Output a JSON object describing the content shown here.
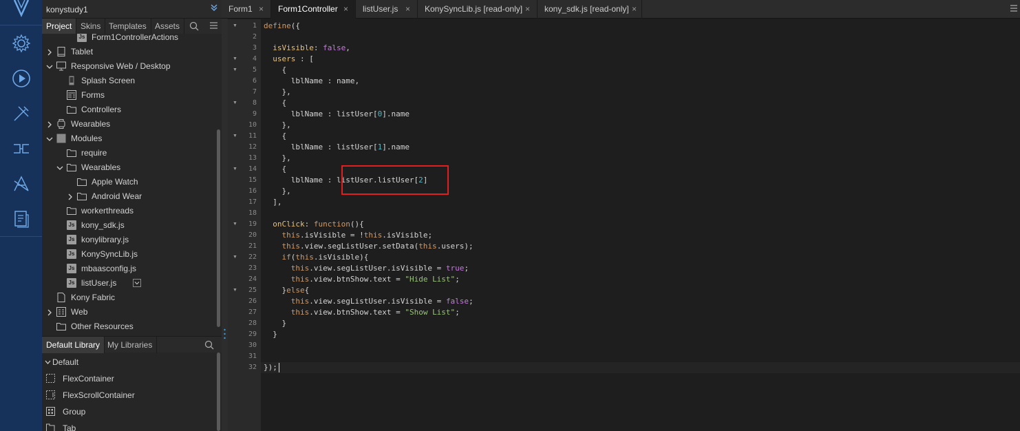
{
  "project_panel": {
    "workspace_name": "konystudy1",
    "tabs": [
      "Project",
      "Skins",
      "Templates",
      "Assets"
    ],
    "tree": [
      {
        "label": "Form1ControllerActions",
        "type": "js",
        "indent": 2,
        "chevron": ""
      },
      {
        "label": "Tablet",
        "type": "tablet",
        "indent": 0,
        "chevron": "right"
      },
      {
        "label": "Responsive Web / Desktop",
        "type": "desktop",
        "indent": 0,
        "chevron": "down"
      },
      {
        "label": "Splash Screen",
        "type": "phone",
        "indent": 1,
        "chevron": ""
      },
      {
        "label": "Forms",
        "type": "forms",
        "indent": 1,
        "chevron": ""
      },
      {
        "label": "Controllers",
        "type": "folder",
        "indent": 1,
        "chevron": ""
      },
      {
        "label": "Wearables",
        "type": "watch",
        "indent": 0,
        "chevron": "right"
      },
      {
        "label": "Modules",
        "type": "modules",
        "indent": 0,
        "chevron": "down"
      },
      {
        "label": "require",
        "type": "folder",
        "indent": 1,
        "chevron": ""
      },
      {
        "label": "Wearables",
        "type": "folder",
        "indent": 1,
        "chevron": "down"
      },
      {
        "label": "Apple Watch",
        "type": "folder",
        "indent": 2,
        "chevron": ""
      },
      {
        "label": "Android Wear",
        "type": "folder",
        "indent": 2,
        "chevron": "right"
      },
      {
        "label": "workerthreads",
        "type": "folder",
        "indent": 1,
        "chevron": ""
      },
      {
        "label": "kony_sdk.js",
        "type": "js",
        "indent": 1,
        "chevron": ""
      },
      {
        "label": "konylibrary.js",
        "type": "js",
        "indent": 1,
        "chevron": ""
      },
      {
        "label": "KonySyncLib.js",
        "type": "js",
        "indent": 1,
        "chevron": ""
      },
      {
        "label": "mbaasconfig.js",
        "type": "js",
        "indent": 1,
        "chevron": ""
      },
      {
        "label": "listUser.js",
        "type": "js",
        "indent": 1,
        "chevron": "",
        "dropdown": true
      },
      {
        "label": "Kony Fabric",
        "type": "file",
        "indent": 0,
        "chevron": ""
      },
      {
        "label": "Web",
        "type": "web",
        "indent": 0,
        "chevron": "right"
      },
      {
        "label": "Other Resources",
        "type": "folder",
        "indent": 0,
        "chevron": ""
      }
    ]
  },
  "library_panel": {
    "tabs": [
      "Default Library",
      "My Libraries"
    ],
    "group_label": "Default",
    "items": [
      "FlexContainer",
      "FlexScrollContainer",
      "Group",
      "Tab"
    ]
  },
  "editor": {
    "tabs": [
      {
        "label": "Form1",
        "active": false
      },
      {
        "label": "Form1Controller",
        "active": true
      },
      {
        "label": "listUser.js",
        "active": false
      },
      {
        "label": "KonySyncLib.js [read-only]",
        "active": false
      },
      {
        "label": "kony_sdk.js [read-only]",
        "active": false
      }
    ],
    "close_glyph": "×",
    "line_numbers": [
      "1",
      "2",
      "3",
      "4",
      "5",
      "6",
      "7",
      "8",
      "9",
      "10",
      "11",
      "12",
      "13",
      "14",
      "15",
      "16",
      "17",
      "18",
      "19",
      "20",
      "21",
      "22",
      "23",
      "24",
      "25",
      "26",
      "27",
      "28",
      "29",
      "30",
      "31",
      "32"
    ],
    "fold_lines": [
      1,
      4,
      5,
      8,
      11,
      14,
      19,
      22,
      25
    ],
    "code_lines": [
      "define({",
      "",
      "  isVisible: false,",
      "  users : [",
      "    {",
      "      lblName : name,",
      "    },",
      "    {",
      "      lblName : listUser[0].name",
      "    },",
      "    {",
      "      lblName : listUser[1].name",
      "    },",
      "    {",
      "      lblName : listUser.listUser[2]",
      "    },",
      "  ],",
      "",
      "  onClick: function(){",
      "    this.isVisible = !this.isVisible;",
      "    this.view.segListUser.setData(this.users);",
      "    if(this.isVisible){",
      "      this.view.segListUser.isVisible = true;",
      "      this.view.btnShow.text = \"Hide List\";",
      "    }else{",
      "      this.view.segListUser.isVisible = false;",
      "      this.view.btnShow.text = \"Show List\";",
      "    }",
      "  }",
      "",
      "",
      "});"
    ]
  },
  "colors": {
    "rail": "#16325a",
    "highlight_box": "#e02020",
    "keyword": "#d19a66",
    "property": "#e6c07b",
    "string": "#98c379",
    "number": "#56b6c2",
    "boolean": "#c678dd"
  }
}
